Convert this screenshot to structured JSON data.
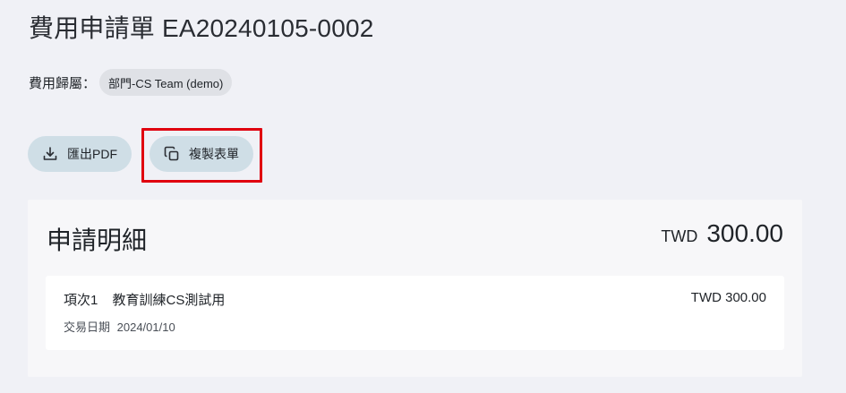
{
  "header": {
    "title": "費用申請單 EA20240105-0002"
  },
  "ownership": {
    "label": "費用歸屬：",
    "value": "部門-CS Team (demo)"
  },
  "actions": {
    "export_label": "匯出PDF",
    "export_icon": "download-icon",
    "copy_label": "複製表單",
    "copy_icon": "copy-icon",
    "highlight_color": "#e0000f"
  },
  "details": {
    "title": "申請明細",
    "total_currency": "TWD",
    "total_amount": "300.00",
    "items": [
      {
        "index_label": "項次1",
        "description": "教育訓練CS測試用",
        "amount": "TWD 300.00",
        "date_label": "交易日期",
        "date": "2024/01/10"
      }
    ]
  }
}
